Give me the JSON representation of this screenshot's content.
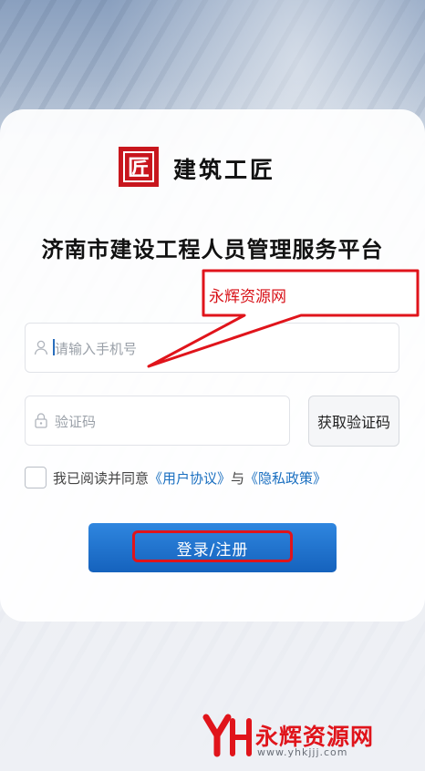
{
  "logo": {
    "mark": "匠",
    "text": "建筑工匠"
  },
  "title": "济南市建设工程人员管理服务平台",
  "phone": {
    "placeholder": "请输入手机号",
    "value": ""
  },
  "code": {
    "placeholder": "验证码",
    "value": ""
  },
  "get_code_label": "获取验证码",
  "agreement": {
    "prefix": "我已阅读并同意",
    "user_agreement": "《用户协议》",
    "and": "与",
    "privacy_policy": "《隐私政策》",
    "checked": false
  },
  "login_label": "登录/注册",
  "annotation": {
    "text": "永辉资源网"
  },
  "watermark": {
    "name": "永辉资源网",
    "url": "www.yhkjjj.com"
  },
  "colors": {
    "primary": "#1a6fc0",
    "brand_red": "#c8161d",
    "annotation_red": "#e0141b"
  },
  "icons": {
    "phone_field": "user-icon",
    "code_field": "lock-icon"
  }
}
